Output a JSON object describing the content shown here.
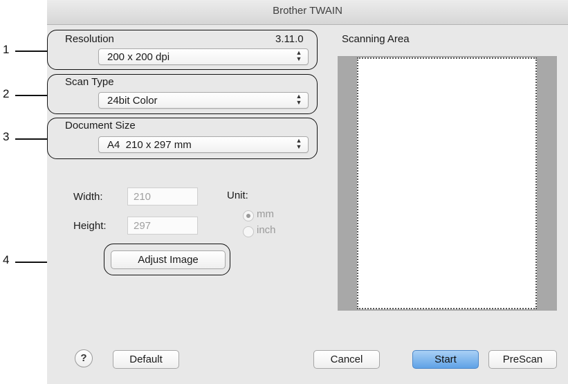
{
  "window": {
    "title": "Brother TWAIN"
  },
  "left_panel": {
    "resolution": {
      "label": "Resolution",
      "value": "200 x 200 dpi"
    },
    "version": "3.11.0",
    "scan_type": {
      "label": "Scan Type",
      "value": "24bit Color"
    },
    "document_size": {
      "label": "Document Size",
      "value": "A4  210 x 297 mm"
    },
    "width": {
      "label": "Width:",
      "value": "210"
    },
    "height": {
      "label": "Height:",
      "value": "297"
    },
    "unit": {
      "label": "Unit:",
      "options": [
        "mm",
        "inch"
      ],
      "selected": "mm"
    },
    "adjust_image_label": "Adjust Image"
  },
  "scanning_area": {
    "label": "Scanning Area"
  },
  "footer": {
    "help_icon": "?",
    "default_label": "Default",
    "cancel_label": "Cancel",
    "start_label": "Start",
    "prescan_label": "PreScan"
  },
  "callouts": [
    "1",
    "2",
    "3",
    "4"
  ],
  "colors": {
    "window_bg": "#e8e8e8",
    "primary_button": "#5fa2e6",
    "scan_frame": "#a8a8a8"
  }
}
